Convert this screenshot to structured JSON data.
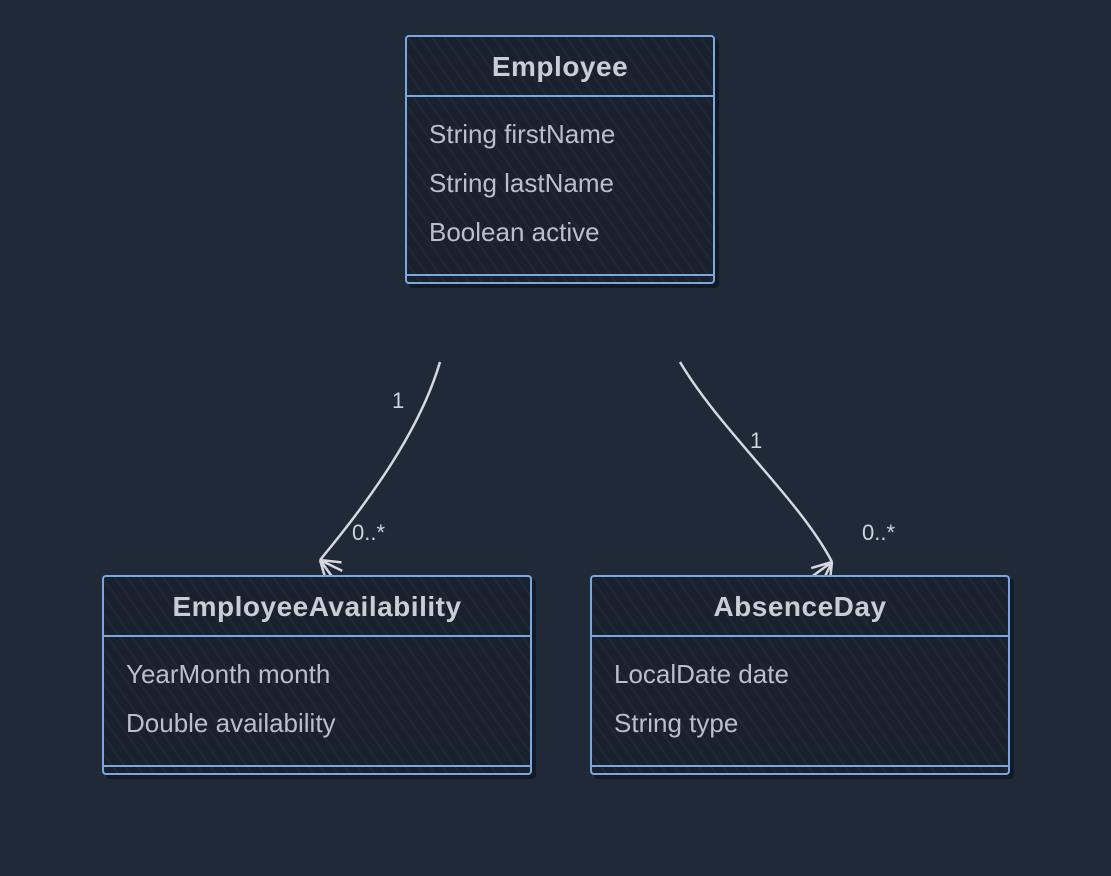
{
  "classes": {
    "employee": {
      "name": "Employee",
      "attributes": [
        "String firstName",
        "String lastName",
        "Boolean active"
      ]
    },
    "employeeAvailability": {
      "name": "EmployeeAvailability",
      "attributes": [
        "YearMonth month",
        "Double availability"
      ]
    },
    "absenceDay": {
      "name": "AbsenceDay",
      "attributes": [
        "LocalDate date",
        "String type"
      ]
    }
  },
  "relations": {
    "empToAvailability": {
      "srcMult": "1",
      "dstMult": "0..*"
    },
    "empToAbsence": {
      "srcMult": "1",
      "dstMult": "0..*"
    }
  },
  "colors": {
    "background": "#1f2937",
    "boxBorder": "#7ba7e0",
    "text": "#c2c6d0",
    "line": "#d6d8de"
  }
}
